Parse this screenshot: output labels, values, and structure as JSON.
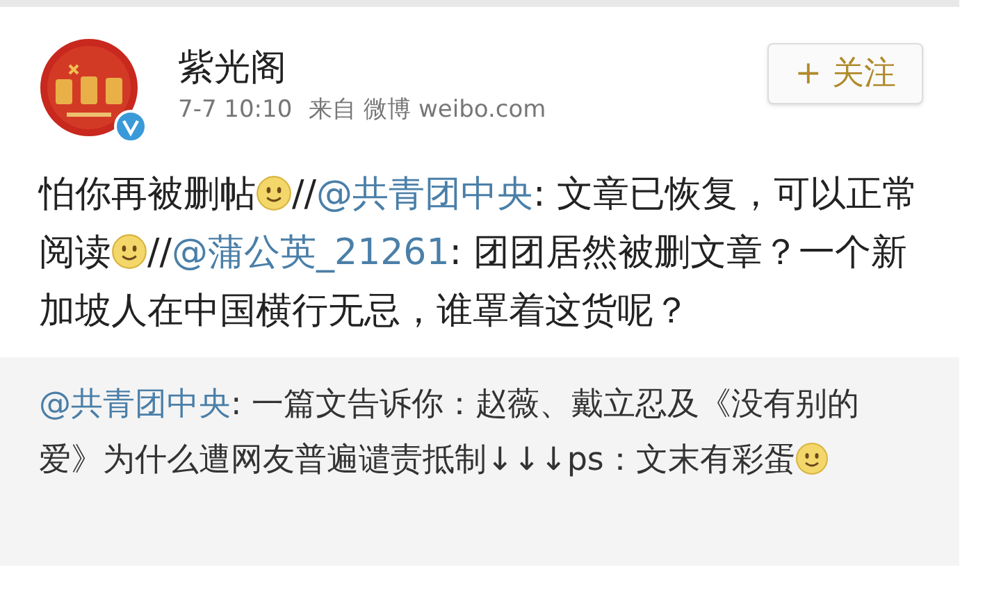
{
  "post": {
    "author": "紫光阁",
    "verified": true,
    "time": "7-7 10:10",
    "source": "来自 微博 weibo.com",
    "follow_button": "+ 关注",
    "text": [
      {
        "kind": "text",
        "text": "怕你再被删帖"
      },
      {
        "kind": "emoji"
      },
      {
        "kind": "text",
        "text": "//"
      },
      {
        "kind": "mention",
        "text": "@共青团中央"
      },
      {
        "kind": "text",
        "text": ": 文章已恢复，可以正常阅读"
      },
      {
        "kind": "emoji"
      },
      {
        "kind": "text",
        "text": "//"
      },
      {
        "kind": "mention",
        "text": "@蒲公英_21261"
      },
      {
        "kind": "text",
        "text": ": 团团居然被删文章？一个新加坡人在中国横行无忌，谁罩着这货呢？"
      }
    ]
  },
  "repost": {
    "text": [
      {
        "kind": "mention",
        "text": "@共青团中央"
      },
      {
        "kind": "text",
        "text": ": 一篇文告诉你：赵薇、戴立忍及《没有别的爱》为什么遭网友普遍谴责抵制↓↓↓ps：文末有彩蛋"
      },
      {
        "kind": "emoji"
      }
    ]
  }
}
